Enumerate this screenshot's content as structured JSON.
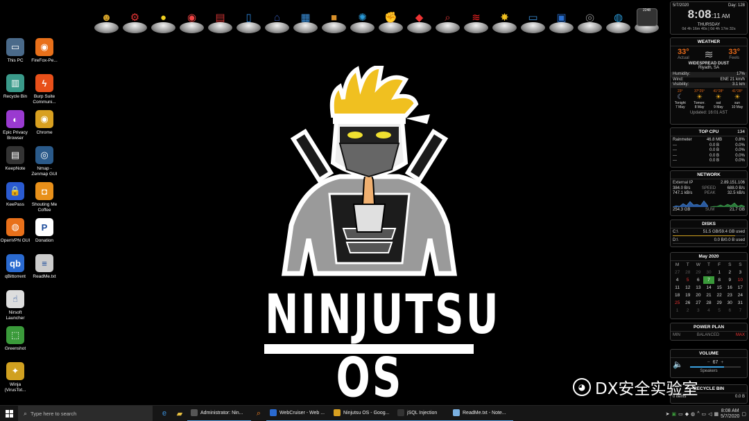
{
  "dock": [
    {
      "icon": "ninja-user-icon",
      "glyph": "☻",
      "color": "#d9a62a"
    },
    {
      "icon": "gears-icon",
      "glyph": "⚙",
      "color": "#d33"
    },
    {
      "icon": "bulb-icon",
      "glyph": "●",
      "color": "#f0d020"
    },
    {
      "icon": "eye-icon",
      "glyph": "◉",
      "color": "#e44"
    },
    {
      "icon": "printer-icon",
      "glyph": "▤",
      "color": "#c33"
    },
    {
      "icon": "phone-icon",
      "glyph": "▯",
      "color": "#2a7fd0"
    },
    {
      "icon": "router-icon",
      "glyph": "⌂",
      "color": "#35a"
    },
    {
      "icon": "browser-lock-icon",
      "glyph": "▦",
      "color": "#3a8ed8"
    },
    {
      "icon": "box-icon",
      "glyph": "■",
      "color": "#d8902a"
    },
    {
      "icon": "gear-network-icon",
      "glyph": "✺",
      "color": "#2a9ad8"
    },
    {
      "icon": "fist-icon",
      "glyph": "✊",
      "color": "#c33"
    },
    {
      "icon": "browser-pin-icon",
      "glyph": "◆",
      "color": "#e33"
    },
    {
      "icon": "search-doc-icon",
      "glyph": "⌕",
      "color": "#c33"
    },
    {
      "icon": "wifi-icon",
      "glyph": "≋",
      "color": "#e22"
    },
    {
      "icon": "star-pin-icon",
      "glyph": "✸",
      "color": "#f0c020"
    },
    {
      "icon": "monitor-icon",
      "glyph": "▭",
      "color": "#3a8ed8"
    },
    {
      "icon": "calendar-doc-icon",
      "glyph": "▣",
      "color": "#2a6fd0"
    },
    {
      "icon": "webcam-icon",
      "glyph": "◎",
      "color": "#888"
    },
    {
      "icon": "camera-icon",
      "glyph": "◍",
      "color": "#2a9ad8"
    },
    {
      "icon": "cpu-meter-icon",
      "glyph": "2248",
      "color": "#444"
    }
  ],
  "desktop": [
    {
      "label": "This PC",
      "icon": "computer-icon",
      "glyph": "▭",
      "bg": "#4a6a8a",
      "col": 0,
      "row": 0
    },
    {
      "label": "FireFox-Pe...",
      "icon": "firefox-icon",
      "glyph": "◉",
      "bg": "#e8701a",
      "col": 1,
      "row": 0
    },
    {
      "label": "Recycle Bin",
      "icon": "recycle-bin-icon",
      "glyph": "▥",
      "bg": "#3a9a8a",
      "col": 0,
      "row": 1
    },
    {
      "label": "Burp Suite Communi...",
      "icon": "burp-suite-icon",
      "glyph": "ϟ",
      "bg": "#e8501a",
      "col": 1,
      "row": 1
    },
    {
      "label": "Epic Privacy Browser",
      "icon": "epic-browser-icon",
      "glyph": "◐",
      "bg": "#9a3ad0",
      "col": 0,
      "row": 2
    },
    {
      "label": "Chrome",
      "icon": "chrome-icon",
      "glyph": "◉",
      "bg": "#d8a020",
      "col": 1,
      "row": 2
    },
    {
      "label": "KeepNote",
      "icon": "keepnote-icon",
      "glyph": "▤",
      "bg": "#333",
      "col": 0,
      "row": 3
    },
    {
      "label": "Nmap - Zenmap GUI",
      "icon": "nmap-eye-icon",
      "glyph": "◎",
      "bg": "#2a5a8a",
      "col": 1,
      "row": 3
    },
    {
      "label": "KeePass",
      "icon": "keepass-lock-icon",
      "glyph": "🔒",
      "bg": "#2a5ad0",
      "col": 0,
      "row": 4
    },
    {
      "label": "Shouting Me Coffee",
      "icon": "coffee-icon",
      "glyph": "◘",
      "bg": "#e8901a",
      "col": 1,
      "row": 4
    },
    {
      "label": "OpenVPN GUI",
      "icon": "openvpn-icon",
      "glyph": "◍",
      "bg": "#e8701a",
      "col": 0,
      "row": 5
    },
    {
      "label": "Donation",
      "icon": "paypal-icon",
      "glyph": "P",
      "bg": "#fff",
      "col": 1,
      "row": 5
    },
    {
      "label": "qBittorrent",
      "icon": "qbittorrent-icon",
      "glyph": "qb",
      "bg": "#2a6ad0",
      "col": 0,
      "row": 6
    },
    {
      "label": "ReadMe.txt",
      "icon": "text-file-icon",
      "glyph": "≡",
      "bg": "#ccc",
      "col": 1,
      "row": 6
    },
    {
      "label": "Nirsoft Launcher",
      "icon": "nirsoft-icon",
      "glyph": "☝",
      "bg": "#ddd",
      "col": 0,
      "row": 7
    },
    {
      "label": "Greenshot",
      "icon": "greenshot-icon",
      "glyph": "⬚",
      "bg": "#3a9a3a",
      "col": 0,
      "row": 8
    },
    {
      "label": "Winja (VirusTot...",
      "icon": "winja-icon",
      "glyph": "✦",
      "bg": "#d0a020",
      "col": 0,
      "row": 9
    }
  ],
  "logo": {
    "title": "NINJUTSU OS"
  },
  "clock": {
    "date": "5/7/2020",
    "day": "Day: 128",
    "time": "8:08",
    "seconds": ":11",
    "ampm": "AM",
    "weekday": "THURSDAY",
    "uptime": "0d 4h 16m 40s | 0d 4h 17m 32s"
  },
  "weather": {
    "title": "WEATHER",
    "actual_temp": "33°",
    "actual_label": "Actual",
    "feels_temp": "33°",
    "feels_label": "Feels",
    "condition": "WIDESPREAD DUST",
    "location": "Riyadh, SA",
    "rows": [
      {
        "k": "Humidity:",
        "v": "17%"
      },
      {
        "k": "Wind:",
        "v": "ENE 21 km/h"
      },
      {
        "k": "Visibility:",
        "v": "3.1 km"
      }
    ],
    "forecast": [
      {
        "temps": "23°",
        "day": "Tonight",
        "date": "7 May"
      },
      {
        "temps": "37°25°",
        "day": "Tomorr.",
        "date": "8 May"
      },
      {
        "temps": "41°28°",
        "day": "sat",
        "date": "9 May"
      },
      {
        "temps": "41°28°",
        "day": "sun",
        "date": "10 May"
      }
    ],
    "updated": "Updated: 16:01 AST"
  },
  "top_cpu": {
    "title": "TOP CPU",
    "count": "134",
    "rows": [
      {
        "name": "Rainmeter",
        "mem": "46.8 MB",
        "cpu": "0.8%"
      },
      {
        "name": "---",
        "mem": "0.0 B",
        "cpu": "0.0%"
      },
      {
        "name": "---",
        "mem": "0.0 B",
        "cpu": "0.0%"
      },
      {
        "name": "---",
        "mem": "0.0 B",
        "cpu": "0.0%"
      },
      {
        "name": "---",
        "mem": "0.0 B",
        "cpu": "0.0%"
      }
    ]
  },
  "network": {
    "title": "NETWORK",
    "external_label": "External IP",
    "external_ip": "2.89.151.106",
    "rows": [
      {
        "a": "384.0 B/s",
        "m": "SPEED",
        "b": "688.0 B/s"
      },
      {
        "a": "747.1 kB/s",
        "m": "PEAK",
        "b": "32.5 kB/s"
      }
    ],
    "totals": {
      "down": "254.3 GB",
      "mid": "SUM",
      "up": "21.7 GB"
    }
  },
  "disks": {
    "title": "DISKS",
    "rows": [
      {
        "drive": "C:\\",
        "used": "51.5 GB/59.4 GB used",
        "fill": 0.87
      },
      {
        "drive": "D:\\",
        "used": "0.0 B/0.0 B used",
        "fill": 0
      }
    ]
  },
  "calendar": {
    "month": "May 2020",
    "weekdays": [
      "M",
      "T",
      "W",
      "T",
      "F",
      "S",
      "S"
    ],
    "days": [
      {
        "d": "27",
        "c": "o"
      },
      {
        "d": "28",
        "c": "o"
      },
      {
        "d": "29",
        "c": "o"
      },
      {
        "d": "30",
        "c": "o"
      },
      {
        "d": "1",
        "c": ""
      },
      {
        "d": "2",
        "c": ""
      },
      {
        "d": "3",
        "c": ""
      },
      {
        "d": "4",
        "c": ""
      },
      {
        "d": "5",
        "c": "r"
      },
      {
        "d": "6",
        "c": ""
      },
      {
        "d": "7",
        "c": "t"
      },
      {
        "d": "8",
        "c": ""
      },
      {
        "d": "9",
        "c": ""
      },
      {
        "d": "10",
        "c": "r"
      },
      {
        "d": "11",
        "c": ""
      },
      {
        "d": "12",
        "c": ""
      },
      {
        "d": "13",
        "c": ""
      },
      {
        "d": "14",
        "c": ""
      },
      {
        "d": "15",
        "c": ""
      },
      {
        "d": "16",
        "c": ""
      },
      {
        "d": "17",
        "c": ""
      },
      {
        "d": "18",
        "c": ""
      },
      {
        "d": "19",
        "c": ""
      },
      {
        "d": "20",
        "c": ""
      },
      {
        "d": "21",
        "c": ""
      },
      {
        "d": "22",
        "c": ""
      },
      {
        "d": "23",
        "c": ""
      },
      {
        "d": "24",
        "c": ""
      },
      {
        "d": "25",
        "c": "r"
      },
      {
        "d": "26",
        "c": ""
      },
      {
        "d": "27",
        "c": ""
      },
      {
        "d": "28",
        "c": ""
      },
      {
        "d": "29",
        "c": ""
      },
      {
        "d": "30",
        "c": ""
      },
      {
        "d": "31",
        "c": ""
      },
      {
        "d": "1",
        "c": "o"
      },
      {
        "d": "2",
        "c": "o"
      },
      {
        "d": "3",
        "c": "o"
      },
      {
        "d": "4",
        "c": "o"
      },
      {
        "d": "5",
        "c": "o"
      },
      {
        "d": "6",
        "c": "o"
      },
      {
        "d": "7",
        "c": "o"
      }
    ]
  },
  "power": {
    "title": "POWER PLAN",
    "min": "MIN",
    "mode": "BALANCED",
    "max": "MAX"
  },
  "volume": {
    "title": "VOLUME",
    "minus": "−",
    "value": "67",
    "plus": "+",
    "device": "Speakers",
    "level": 0.67
  },
  "recycle": {
    "title": "RECYCLE BIN",
    "items": "0 items",
    "size": "0.0 B"
  },
  "taskbar": {
    "search_placeholder": "Type here to search",
    "tasks": [
      {
        "label": "Administrator: Nin...",
        "icon": "terminal-icon",
        "color": "#555"
      },
      {
        "label": "WebCruiser - Web ...",
        "icon": "webcruiser-icon",
        "color": "#2a6ad0"
      },
      {
        "label": "Ninjutsu OS - Goog...",
        "icon": "chrome-icon",
        "color": "#d8a020"
      },
      {
        "label": "jSQL Injection",
        "icon": "jsql-icon",
        "color": "#333"
      },
      {
        "label": "ReadMe.txt - Note...",
        "icon": "notepad-icon",
        "color": "#7ab0e0"
      }
    ],
    "time": "8:08 AM",
    "date": "5/7/2020"
  },
  "watermark": {
    "text": "DX安全实验室"
  }
}
